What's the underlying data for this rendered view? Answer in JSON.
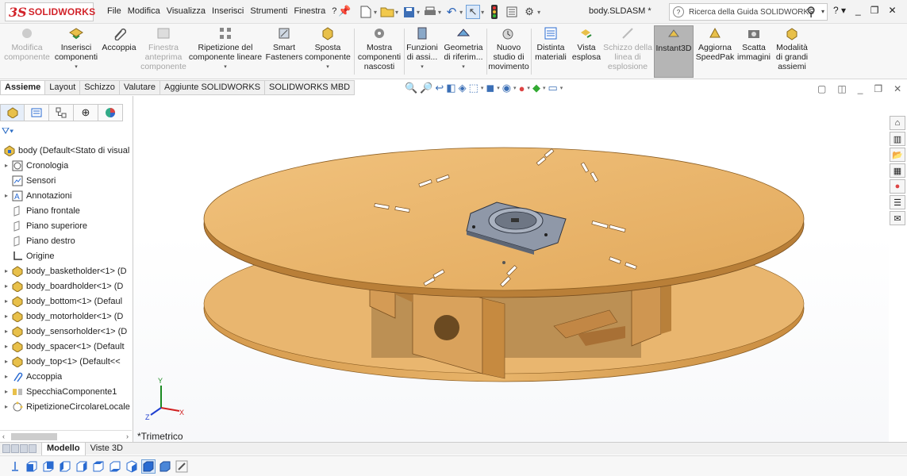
{
  "app": {
    "logo_ds": "3S",
    "logo_text": "SOLIDWORKS",
    "doc_title": "body.SLDASM *"
  },
  "menu": [
    "File",
    "Modifica",
    "Visualizza",
    "Inserisci",
    "Strumenti",
    "Finestra",
    "?"
  ],
  "search": {
    "placeholder": "Ricerca della Guida SOLIDWORKS"
  },
  "ribbon": [
    {
      "l1": "Modifica",
      "l2": "componente",
      "l3": "",
      "disabled": true,
      "arrow": false
    },
    {
      "l1": "Inserisci",
      "l2": "componenti",
      "l3": "",
      "disabled": false,
      "arrow": true
    },
    {
      "l1": "Accoppia",
      "l2": "",
      "l3": "",
      "disabled": false,
      "arrow": false
    },
    {
      "l1": "Finestra",
      "l2": "anteprima",
      "l3": "componente",
      "disabled": true,
      "arrow": false
    },
    {
      "l1": "Ripetizione del",
      "l2": "componente lineare",
      "l3": "",
      "disabled": false,
      "arrow": true
    },
    {
      "l1": "Smart",
      "l2": "Fasteners",
      "l3": "",
      "disabled": false,
      "arrow": false
    },
    {
      "l1": "Sposta",
      "l2": "componente",
      "l3": "",
      "disabled": false,
      "arrow": true
    },
    {
      "l1": "Mostra",
      "l2": "componenti",
      "l3": "nascosti",
      "disabled": false,
      "arrow": false
    },
    {
      "l1": "Funzioni",
      "l2": "di assi...",
      "l3": "",
      "disabled": false,
      "arrow": true
    },
    {
      "l1": "Geometria",
      "l2": "di riferim...",
      "l3": "",
      "disabled": false,
      "arrow": true
    },
    {
      "l1": "Nuovo",
      "l2": "studio di",
      "l3": "movimento",
      "disabled": false,
      "arrow": false
    },
    {
      "l1": "Distinta",
      "l2": "materiali",
      "l3": "",
      "disabled": false,
      "arrow": false
    },
    {
      "l1": "Vista",
      "l2": "esplosa",
      "l3": "",
      "disabled": false,
      "arrow": false
    },
    {
      "l1": "Schizzo della",
      "l2": "linea di",
      "l3": "esplosione",
      "disabled": true,
      "arrow": false
    },
    {
      "l1": "Instant3D",
      "l2": "",
      "l3": "",
      "disabled": false,
      "arrow": false
    },
    {
      "l1": "Aggiorna",
      "l2": "SpeedPak",
      "l3": "",
      "disabled": false,
      "arrow": false
    },
    {
      "l1": "Scatta",
      "l2": "immagini",
      "l3": "",
      "disabled": false,
      "arrow": false
    },
    {
      "l1": "Modalità",
      "l2": "di grandi",
      "l3": "assiemi",
      "disabled": false,
      "arrow": false
    }
  ],
  "cmtabs": [
    "Assieme",
    "Layout",
    "Schizzo",
    "Valutare",
    "Aggiunte SOLIDWORKS",
    "SOLIDWORKS MBD"
  ],
  "tree": [
    {
      "label": "body  (Default<Stato di visual",
      "icon": "assembly",
      "expand": false,
      "indent": 0
    },
    {
      "label": "Cronologia",
      "icon": "history",
      "expand": true,
      "indent": 1
    },
    {
      "label": "Sensori",
      "icon": "sensor",
      "expand": false,
      "indent": 1
    },
    {
      "label": "Annotazioni",
      "icon": "annotation",
      "expand": true,
      "indent": 1
    },
    {
      "label": "Piano frontale",
      "icon": "plane",
      "expand": false,
      "indent": 1
    },
    {
      "label": "Piano superiore",
      "icon": "plane",
      "expand": false,
      "indent": 1
    },
    {
      "label": "Piano destro",
      "icon": "plane",
      "expand": false,
      "indent": 1
    },
    {
      "label": "Origine",
      "icon": "origin",
      "expand": false,
      "indent": 1
    },
    {
      "label": "body_basketholder<1> (D",
      "icon": "part",
      "expand": true,
      "indent": 1
    },
    {
      "label": "body_boardholder<1> (D",
      "icon": "part",
      "expand": true,
      "indent": 1
    },
    {
      "label": "body_bottom<1> (Defaul",
      "icon": "part",
      "expand": true,
      "indent": 1
    },
    {
      "label": "body_motorholder<1> (D",
      "icon": "part",
      "expand": true,
      "indent": 1
    },
    {
      "label": "body_sensorholder<1> (D",
      "icon": "part",
      "expand": true,
      "indent": 1
    },
    {
      "label": "body_spacer<1> (Default",
      "icon": "part",
      "expand": true,
      "indent": 1
    },
    {
      "label": "body_top<1> (Default<<",
      "icon": "part",
      "expand": true,
      "indent": 1
    },
    {
      "label": "Accoppia",
      "icon": "mate",
      "expand": true,
      "indent": 1
    },
    {
      "label": "SpecchiaComponente1",
      "icon": "mirror",
      "expand": true,
      "indent": 1
    },
    {
      "label": "RipetizioneCircolareLocale",
      "icon": "pattern",
      "expand": true,
      "indent": 1
    }
  ],
  "bottom_tabs": [
    "Modello",
    "Viste 3D"
  ],
  "view_label": "*Trimetrico",
  "colors": {
    "wood": "#e8b46a",
    "wood_dark": "#c98c3f",
    "accent": "#d2232a"
  }
}
